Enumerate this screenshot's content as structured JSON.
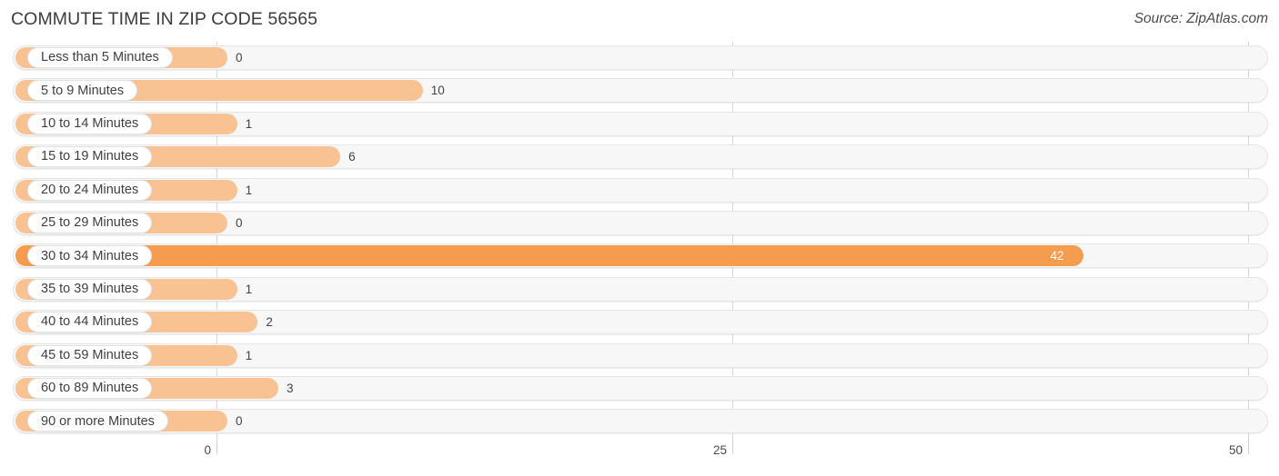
{
  "header": {
    "title": "COMMUTE TIME IN ZIP CODE 56565",
    "source": "Source: ZipAtlas.com"
  },
  "colors": {
    "bar_light": "#f9c293",
    "bar_strong": "#f59c4e",
    "track": "#f7f7f7",
    "gridline": "#d8d8d8",
    "label_text": "#3f3f3f",
    "value_text": "#444444",
    "value_text_inverse": "#ffffff"
  },
  "axis": {
    "ticks": [
      {
        "label": "0",
        "value": 0
      },
      {
        "label": "25",
        "value": 25
      },
      {
        "label": "50",
        "value": 50
      }
    ],
    "min": 0,
    "max": 50
  },
  "chart_data": {
    "type": "bar",
    "orientation": "horizontal",
    "title": "COMMUTE TIME IN ZIP CODE 56565",
    "subtitle": "Source: ZipAtlas.com",
    "xlabel": "",
    "ylabel": "",
    "xlim": [
      0,
      50
    ],
    "xticks": [
      0,
      25,
      50
    ],
    "grid": true,
    "legend": "none",
    "categories": [
      "Less than 5 Minutes",
      "5 to 9 Minutes",
      "10 to 14 Minutes",
      "15 to 19 Minutes",
      "20 to 24 Minutes",
      "25 to 29 Minutes",
      "30 to 34 Minutes",
      "35 to 39 Minutes",
      "40 to 44 Minutes",
      "45 to 59 Minutes",
      "60 to 89 Minutes",
      "90 or more Minutes"
    ],
    "values": [
      0,
      10,
      1,
      6,
      1,
      0,
      42,
      1,
      2,
      1,
      3,
      0
    ],
    "value_labels": [
      "0",
      "10",
      "1",
      "6",
      "1",
      "0",
      "42",
      "1",
      "2",
      "1",
      "3",
      "0"
    ],
    "highlight_index": 6
  },
  "bars": [
    {
      "label": "Less than 5 Minutes",
      "value": 0,
      "value_label": "0",
      "highlight": false
    },
    {
      "label": "5 to 9 Minutes",
      "value": 10,
      "value_label": "10",
      "highlight": false
    },
    {
      "label": "10 to 14 Minutes",
      "value": 1,
      "value_label": "1",
      "highlight": false
    },
    {
      "label": "15 to 19 Minutes",
      "value": 6,
      "value_label": "6",
      "highlight": false
    },
    {
      "label": "20 to 24 Minutes",
      "value": 1,
      "value_label": "1",
      "highlight": false
    },
    {
      "label": "25 to 29 Minutes",
      "value": 0,
      "value_label": "0",
      "highlight": false
    },
    {
      "label": "30 to 34 Minutes",
      "value": 42,
      "value_label": "42",
      "highlight": true
    },
    {
      "label": "35 to 39 Minutes",
      "value": 1,
      "value_label": "1",
      "highlight": false
    },
    {
      "label": "40 to 44 Minutes",
      "value": 2,
      "value_label": "2",
      "highlight": false
    },
    {
      "label": "45 to 59 Minutes",
      "value": 1,
      "value_label": "1",
      "highlight": false
    },
    {
      "label": "60 to 89 Minutes",
      "value": 3,
      "value_label": "3",
      "highlight": false
    },
    {
      "label": "90 or more Minutes",
      "value": 0,
      "value_label": "0",
      "highlight": false
    }
  ]
}
